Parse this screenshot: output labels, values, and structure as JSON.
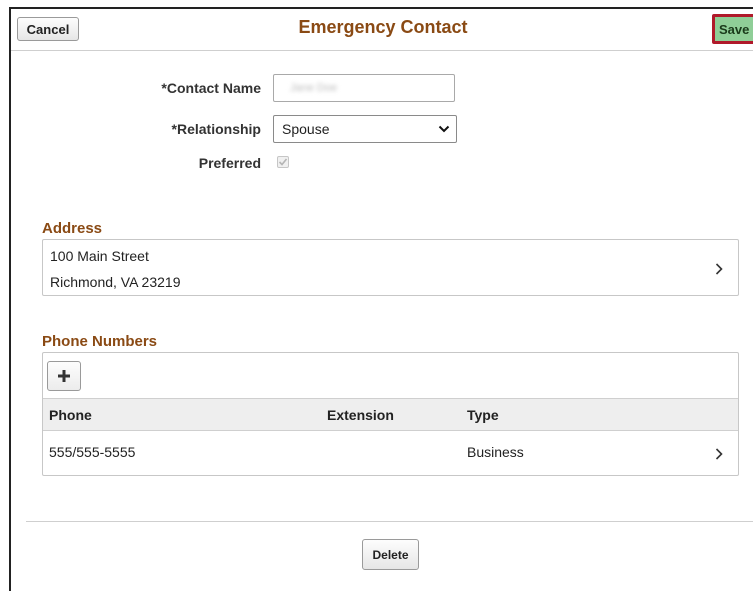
{
  "header": {
    "title": "Emergency Contact",
    "cancel_label": "Cancel",
    "save_label": "Save"
  },
  "form": {
    "contact_name_label": "*Contact Name",
    "contact_name_value": "Jane Doe",
    "relationship_label": "*Relationship",
    "relationship_value": "Spouse",
    "preferred_label": "Preferred",
    "preferred_checked": true
  },
  "address": {
    "title": "Address",
    "line1": "100 Main Street",
    "line2": "Richmond, VA 23219"
  },
  "phones": {
    "title": "Phone Numbers",
    "columns": [
      "Phone",
      "Extension",
      "Type"
    ],
    "rows": [
      {
        "phone": "555/555-5555",
        "extension": "",
        "type": "Business"
      }
    ]
  },
  "footer": {
    "delete_label": "Delete"
  },
  "colors": {
    "title": "#8a4a14",
    "save_bg": "#8fce97",
    "save_border": "#b0192a"
  }
}
